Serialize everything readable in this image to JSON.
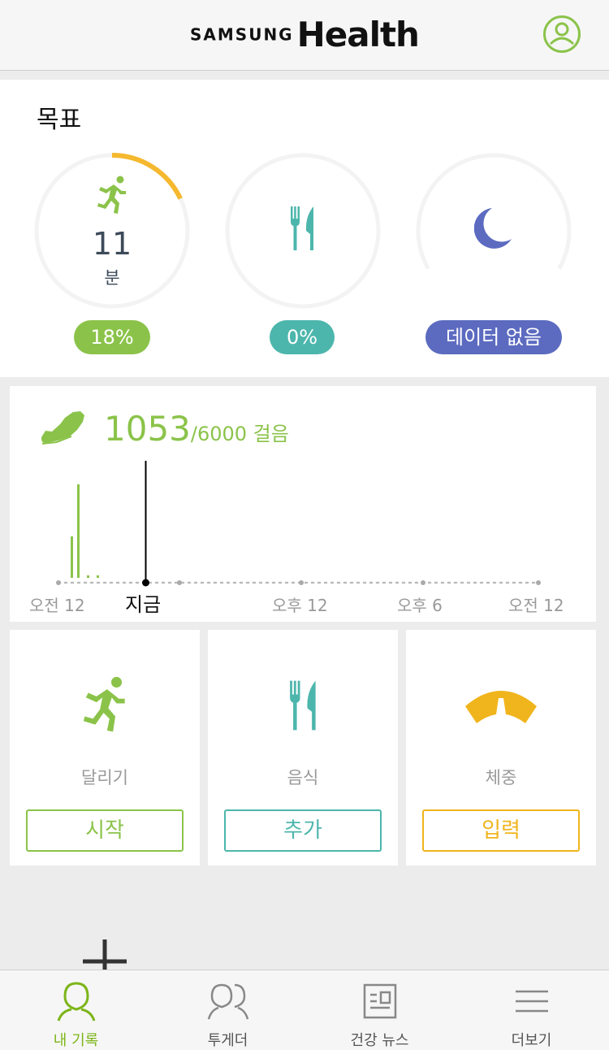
{
  "header": {
    "logo_brand": "SAMSUNG",
    "logo_product": "Health",
    "profile_icon": "profile-icon",
    "accent_color": "#8bc34a"
  },
  "goals": {
    "title": "목표",
    "activity": {
      "icon": "running-icon",
      "value": "11",
      "unit": "분",
      "percent_label": "18%",
      "progress": 0.18,
      "color": "#f5b82e",
      "pill_color": "#8bc34a"
    },
    "food": {
      "icon": "fork-knife-icon",
      "percent_label": "0%",
      "progress": 0,
      "pill_color": "#4db6ac"
    },
    "sleep": {
      "icon": "moon-icon",
      "status_label": "데이터 없음",
      "pill_color": "#5c6bc0"
    }
  },
  "steps": {
    "icon": "shoe-icon",
    "count": "1053",
    "goal_text": "/6000 걸음",
    "time_labels": {
      "start": "오전 12",
      "now": "지금",
      "noon": "오후 12",
      "evening": "오후 6",
      "end": "오전 12"
    }
  },
  "tiles": [
    {
      "label": "달리기",
      "button": "시작",
      "icon": "running-icon",
      "color": "#8bc34a"
    },
    {
      "label": "음식",
      "button": "추가",
      "icon": "fork-knife-icon",
      "color": "#4db6ac"
    },
    {
      "label": "체중",
      "button": "입력",
      "icon": "scale-icon",
      "color": "#f0b41c"
    }
  ],
  "fab": {
    "icon": "plus-icon"
  },
  "bottom_nav": [
    {
      "label": "내 기록",
      "icon": "person-icon",
      "active": true
    },
    {
      "label": "투게더",
      "icon": "people-icon",
      "active": false
    },
    {
      "label": "건강 뉴스",
      "icon": "news-icon",
      "active": false
    },
    {
      "label": "더보기",
      "icon": "menu-icon",
      "active": false
    }
  ]
}
